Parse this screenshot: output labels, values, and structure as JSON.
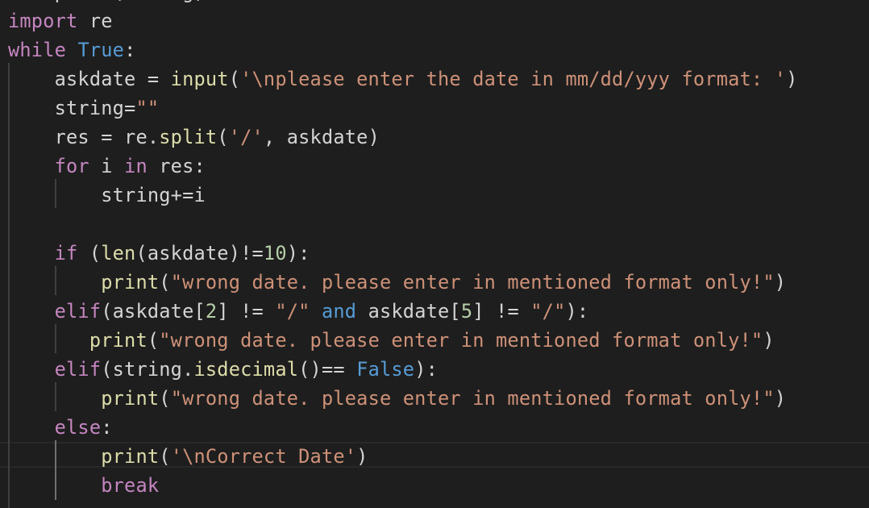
{
  "editor": {
    "language": "python",
    "theme": {
      "background": "#1e1e1e",
      "keyword": "#c586c0",
      "constant": "#569cd6",
      "function": "#dcdcaa",
      "string": "#ce9178",
      "number": "#b5cea8",
      "text": "#d4d4d4"
    },
    "clipped_top_line": "    print(string)",
    "lines": [
      {
        "tokens": [
          [
            "kw",
            "import"
          ],
          [
            "plain",
            " re"
          ]
        ]
      },
      {
        "tokens": [
          [
            "kw",
            "while"
          ],
          [
            "plain",
            " "
          ],
          [
            "const",
            "True"
          ],
          [
            "plain",
            ":"
          ]
        ]
      },
      {
        "tokens": [
          [
            "plain",
            "    askdate = "
          ],
          [
            "fn",
            "input"
          ],
          [
            "plain",
            "("
          ],
          [
            "str",
            "'\\nplease enter the date in mm/dd/yyy format: '"
          ],
          [
            "plain",
            ")"
          ]
        ]
      },
      {
        "tokens": [
          [
            "plain",
            "    string="
          ],
          [
            "str",
            "\"\""
          ]
        ]
      },
      {
        "tokens": [
          [
            "plain",
            "    res = re."
          ],
          [
            "fn",
            "split"
          ],
          [
            "plain",
            "("
          ],
          [
            "str",
            "'/'"
          ],
          [
            "plain",
            ", askdate)"
          ]
        ]
      },
      {
        "tokens": [
          [
            "plain",
            "    "
          ],
          [
            "kw",
            "for"
          ],
          [
            "plain",
            " i "
          ],
          [
            "kw",
            "in"
          ],
          [
            "plain",
            " res:"
          ]
        ]
      },
      {
        "tokens": [
          [
            "plain",
            "        string+=i"
          ]
        ]
      },
      {
        "tokens": []
      },
      {
        "tokens": [
          [
            "plain",
            "    "
          ],
          [
            "kw",
            "if"
          ],
          [
            "plain",
            " ("
          ],
          [
            "fn",
            "len"
          ],
          [
            "plain",
            "(askdate)!="
          ],
          [
            "num",
            "10"
          ],
          [
            "plain",
            "):"
          ]
        ]
      },
      {
        "tokens": [
          [
            "plain",
            "        "
          ],
          [
            "fn",
            "print"
          ],
          [
            "plain",
            "("
          ],
          [
            "str",
            "\"wrong date. please enter in mentioned format only!\""
          ],
          [
            "plain",
            ")"
          ]
        ]
      },
      {
        "tokens": [
          [
            "plain",
            "    "
          ],
          [
            "kw",
            "elif"
          ],
          [
            "plain",
            "(askdate["
          ],
          [
            "num",
            "2"
          ],
          [
            "plain",
            "] != "
          ],
          [
            "str",
            "\"/\""
          ],
          [
            "plain",
            " "
          ],
          [
            "const",
            "and"
          ],
          [
            "plain",
            " askdate["
          ],
          [
            "num",
            "5"
          ],
          [
            "plain",
            "] != "
          ],
          [
            "str",
            "\"/\""
          ],
          [
            "plain",
            "):"
          ]
        ]
      },
      {
        "tokens": [
          [
            "plain",
            "       "
          ],
          [
            "fn",
            "print"
          ],
          [
            "plain",
            "("
          ],
          [
            "str",
            "\"wrong date. please enter in mentioned format only!\""
          ],
          [
            "plain",
            ")"
          ]
        ]
      },
      {
        "tokens": [
          [
            "plain",
            "    "
          ],
          [
            "kw",
            "elif"
          ],
          [
            "plain",
            "(string."
          ],
          [
            "fn",
            "isdecimal"
          ],
          [
            "plain",
            "()== "
          ],
          [
            "const",
            "False"
          ],
          [
            "plain",
            "):"
          ]
        ]
      },
      {
        "tokens": [
          [
            "plain",
            "        "
          ],
          [
            "fn",
            "print"
          ],
          [
            "plain",
            "("
          ],
          [
            "str",
            "\"wrong date. please enter in mentioned format only!\""
          ],
          [
            "plain",
            ")"
          ]
        ]
      },
      {
        "tokens": [
          [
            "plain",
            "    "
          ],
          [
            "kw",
            "else"
          ],
          [
            "plain",
            ":"
          ]
        ]
      },
      {
        "tokens": [
          [
            "plain",
            "        "
          ],
          [
            "fn",
            "print"
          ],
          [
            "plain",
            "("
          ],
          [
            "str",
            "'\\nCorrect Date'"
          ],
          [
            "plain",
            ")"
          ]
        ]
      },
      {
        "tokens": [
          [
            "plain",
            "        "
          ],
          [
            "kw",
            "break"
          ]
        ]
      }
    ],
    "current_line_index": 15
  }
}
